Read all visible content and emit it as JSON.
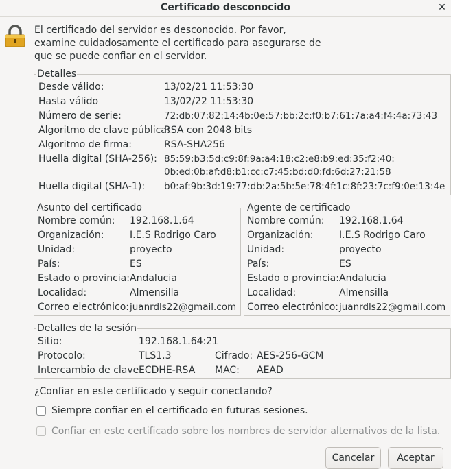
{
  "window": {
    "title": "Certificado desconocido"
  },
  "message": "El certificado del servidor es desconocido. Por favor, examine cuidadosamente el certificado para asegurarse de que se puede confiar en el servidor.",
  "details": {
    "legend": "Detalles",
    "valid_from_label": "Desde válido:",
    "valid_from": "13/02/21 11:53:30",
    "valid_to_label": "Hasta válido",
    "valid_to": "13/02/22 11:53:30",
    "serial_label": "Número de serie:",
    "serial": "72:db:07:82:14:4b:0e:57:bb:2c:f0:b7:61:7a:a4:f4:4a:73:43",
    "pubkey_label": "Algoritmo de clave pública:",
    "pubkey": "RSA con 2048 bits",
    "sigalg_label": "Algoritmo de firma:",
    "sigalg": "RSA-SHA256",
    "sha256_label": "Huella digital (SHA-256):",
    "sha256_line1": "85:59:b3:5d:c9:8f:9a:a4:18:c2:e8:b9:ed:35:f2:40:",
    "sha256_line2": "0b:ed:0b:af:d8:b1:cc:c7:45:bd:d0:fd:6d:27:21:58",
    "sha1_label": "Huella digital (SHA-1):",
    "sha1": "b0:af:9b:3d:19:77:db:2a:5b:5e:78:4f:1c:8f:23:7c:f9:0e:13:4e"
  },
  "subject": {
    "legend": "Asunto del certificado",
    "rows": [
      {
        "label": "Nombre común:",
        "value": "192.168.1.64"
      },
      {
        "label": "Organización:",
        "value": "I.E.S Rodrigo Caro"
      },
      {
        "label": "Unidad:",
        "value": "proyecto"
      },
      {
        "label": "País:",
        "value": "ES"
      },
      {
        "label": "Estado o provincia:",
        "value": "Andalucia"
      },
      {
        "label": "Localidad:",
        "value": "Almensilla"
      },
      {
        "label": "Correo electrónico:",
        "value": "juanrdls22@gmail.com"
      }
    ]
  },
  "issuer": {
    "legend": "Agente de certificado",
    "rows": [
      {
        "label": "Nombre común:",
        "value": "192.168.1.64"
      },
      {
        "label": "Organización:",
        "value": "I.E.S Rodrigo Caro"
      },
      {
        "label": "Unidad:",
        "value": "proyecto"
      },
      {
        "label": "País:",
        "value": "ES"
      },
      {
        "label": "Estado o provincia:",
        "value": "Andalucia"
      },
      {
        "label": "Localidad:",
        "value": "Almensilla"
      },
      {
        "label": "Correo electrónico:",
        "value": "juanrdls22@gmail.com"
      }
    ]
  },
  "session": {
    "legend": "Detalles de la sesión",
    "site_label": "Sitio:",
    "site": "192.168.1.64:21",
    "protocol_label": "Protocolo:",
    "protocol": "TLS1.3",
    "cipher_label": "Cifrado:",
    "cipher": "AES-256-GCM",
    "kex_label": "Intercambio de clave:",
    "kex": "ECDHE-RSA",
    "mac_label": "MAC:",
    "mac": "AEAD"
  },
  "question": "¿Confiar en este certificado y seguir conectando?",
  "options": {
    "always_trust": "Siempre confiar en el certificado en futuras sesiones.",
    "trust_alt_names": "Confiar en este certificado sobre los nombres de servidor alternativos de la lista."
  },
  "buttons": {
    "cancel": "Cancelar",
    "accept": "Aceptar"
  },
  "icons": {
    "close": "close-icon",
    "lock": "padlock-icon"
  },
  "colors": {
    "lock_body": "#e0a421",
    "lock_shackle": "#555753"
  }
}
